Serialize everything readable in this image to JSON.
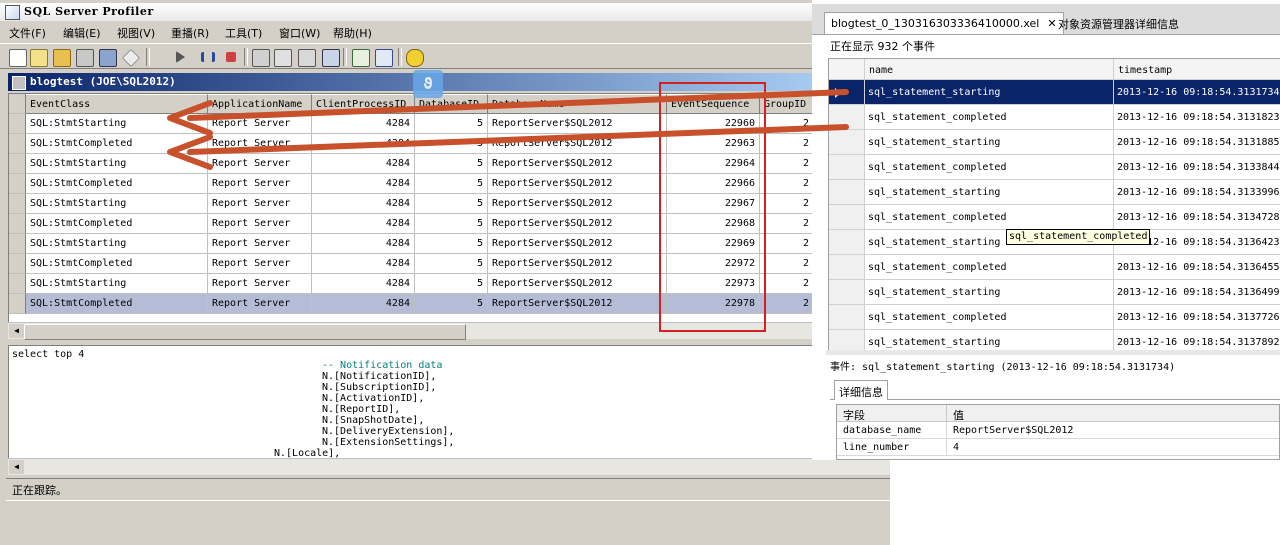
{
  "profiler": {
    "title": "SQL Server Profiler",
    "menu": [
      "文件(F)",
      "编辑(E)",
      "视图(V)",
      "重播(R)",
      "工具(T)",
      "窗口(W)",
      "帮助(H)"
    ],
    "toolbar_icons": [
      "new-trace-icon",
      "new-template-icon",
      "open-icon",
      "properties-icon",
      "save-icon",
      "eraser-icon",
      "run-icon",
      "pause-icon",
      "stop-icon",
      "filter-icon",
      "column-icon",
      "find-icon",
      "autoscroll-icon",
      "activity-monitor-icon",
      "tuning-advisor-icon",
      "help-icon"
    ],
    "trace_title": "blogtest (JOE\\SQL2012)",
    "columns": [
      "EventClass",
      "ApplicationName",
      "ClientProcessID",
      "DatabaseID",
      "DatabaseName",
      "EventSequence",
      "GroupID"
    ],
    "column_display": [
      "EventClass",
      "ApplicationName",
      "ClientProcessID",
      "DatabaseID",
      "DatabaseName",
      "EventSequence",
      "GroupID"
    ],
    "rows": [
      {
        "event": "SQL:StmtStarting",
        "app": "Report Server",
        "pid": "4284",
        "dbid": "5",
        "dbname": "ReportServer$SQL2012",
        "seq": "22960",
        "grp": "2"
      },
      {
        "event": "SQL:StmtCompleted",
        "app": "Report Server",
        "pid": "4284",
        "dbid": "5",
        "dbname": "ReportServer$SQL2012",
        "seq": "22963",
        "grp": "2"
      },
      {
        "event": "SQL:StmtStarting",
        "app": "Report Server",
        "pid": "4284",
        "dbid": "5",
        "dbname": "ReportServer$SQL2012",
        "seq": "22964",
        "grp": "2"
      },
      {
        "event": "SQL:StmtCompleted",
        "app": "Report Server",
        "pid": "4284",
        "dbid": "5",
        "dbname": "ReportServer$SQL2012",
        "seq": "22966",
        "grp": "2"
      },
      {
        "event": "SQL:StmtStarting",
        "app": "Report Server",
        "pid": "4284",
        "dbid": "5",
        "dbname": "ReportServer$SQL2012",
        "seq": "22967",
        "grp": "2"
      },
      {
        "event": "SQL:StmtCompleted",
        "app": "Report Server",
        "pid": "4284",
        "dbid": "5",
        "dbname": "ReportServer$SQL2012",
        "seq": "22968",
        "grp": "2"
      },
      {
        "event": "SQL:StmtStarting",
        "app": "Report Server",
        "pid": "4284",
        "dbid": "5",
        "dbname": "ReportServer$SQL2012",
        "seq": "22969",
        "grp": "2"
      },
      {
        "event": "SQL:StmtCompleted",
        "app": "Report Server",
        "pid": "4284",
        "dbid": "5",
        "dbname": "ReportServer$SQL2012",
        "seq": "22972",
        "grp": "2"
      },
      {
        "event": "SQL:StmtStarting",
        "app": "Report Server",
        "pid": "4284",
        "dbid": "5",
        "dbname": "ReportServer$SQL2012",
        "seq": "22973",
        "grp": "2"
      },
      {
        "event": "SQL:StmtCompleted",
        "app": "Report Server",
        "pid": "4284",
        "dbid": "5",
        "dbname": "ReportServer$SQL2012",
        "seq": "22978",
        "grp": "2",
        "selected": true
      }
    ],
    "sql_lines": [
      {
        "text": "select top 4",
        "indent": 0,
        "comment": false
      },
      {
        "text": "-- Notification data",
        "indent": 1,
        "comment": true
      },
      {
        "text": "N.[NotificationID],",
        "indent": 1,
        "comment": false
      },
      {
        "text": "N.[SubscriptionID],",
        "indent": 1,
        "comment": false
      },
      {
        "text": "N.[ActivationID],",
        "indent": 1,
        "comment": false
      },
      {
        "text": "N.[ReportID],",
        "indent": 1,
        "comment": false
      },
      {
        "text": "N.[SnapShotDate],",
        "indent": 1,
        "comment": false
      },
      {
        "text": "N.[DeliveryExtension],",
        "indent": 1,
        "comment": false
      },
      {
        "text": "N.[ExtensionSettings],",
        "indent": 1,
        "comment": false
      },
      {
        "text": "N.[Locale],",
        "indent": 2,
        "comment": false
      }
    ],
    "status": "正在跟踪。"
  },
  "xel": {
    "tab_active": "blogtest_0_130316303336410000.xel",
    "tab_close": "✕",
    "tab_other": "对象资源管理器详细信息",
    "event_count": "正在显示 932 个事件",
    "columns": [
      "name",
      "timestamp"
    ],
    "rows": [
      {
        "name": "sql_statement_starting",
        "ts": "2013-12-16 09:18:54.3131734",
        "selected": true
      },
      {
        "name": "sql_statement_completed",
        "ts": "2013-12-16 09:18:54.3131823"
      },
      {
        "name": "sql_statement_starting",
        "ts": "2013-12-16 09:18:54.3131885"
      },
      {
        "name": "sql_statement_completed",
        "ts": "2013-12-16 09:18:54.3133844"
      },
      {
        "name": "sql_statement_starting",
        "ts": "2013-12-16 09:18:54.3133996"
      },
      {
        "name": "sql_statement_completed",
        "ts": "2013-12-16 09:18:54.3134728"
      },
      {
        "name": "sql_statement_starting",
        "ts": "2013-12-16 09:18:54.3136423"
      },
      {
        "name": "sql_statement_completed",
        "ts": "2013-12-16 09:18:54.3136455"
      },
      {
        "name": "sql_statement_starting",
        "ts": "2013-12-16 09:18:54.3136499"
      },
      {
        "name": "sql_statement_completed",
        "ts": "2013-12-16 09:18:54.3137726"
      },
      {
        "name": "sql_statement_starting",
        "ts": "2013-12-16 09:18:54.3137892"
      }
    ],
    "tooltip": "sql_statement_completed",
    "event_detail": "事件: sql_statement_starting (2013-12-16 09:18:54.3131734)",
    "detail_tab": "详细信息",
    "detail_headers": [
      "字段",
      "值"
    ],
    "details": [
      {
        "field": "database_name",
        "value": "ReportServer$SQL2012"
      },
      {
        "field": "line_number",
        "value": "4"
      }
    ]
  },
  "colors": {
    "arrow": "#c8502a",
    "highlight_box": "#d42020",
    "selection": "#0a246a",
    "profiler_selection": "#b5bcd6"
  }
}
